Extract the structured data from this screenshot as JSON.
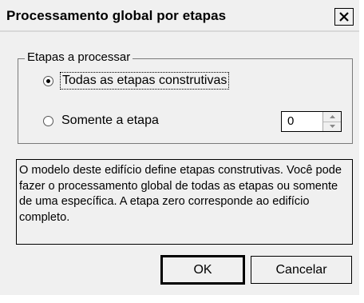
{
  "dialog": {
    "title": "Processamento global por etapas",
    "close_icon": "close-icon"
  },
  "group": {
    "legend": "Etapas a processar",
    "options": [
      {
        "label": "Todas as etapas construtivas",
        "checked": true
      },
      {
        "label": "Somente a etapa",
        "checked": false
      }
    ],
    "stage_value": "0"
  },
  "info": {
    "text": "O modelo deste edifício define etapas construtivas. Você pode fazer o processamento global de todas as etapas ou somente de uma específica. A etapa zero corresponde ao edifício completo."
  },
  "buttons": {
    "ok_label": "OK",
    "cancel_label": "Cancelar"
  }
}
